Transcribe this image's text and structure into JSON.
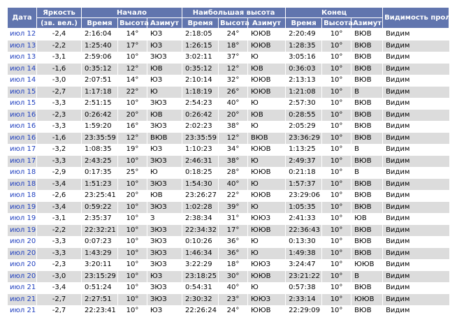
{
  "headers": {
    "date": "Дата",
    "brightness_line1": "Яркость",
    "brightness_line2": "(зв. вел.)",
    "start": "Начало",
    "max": "Наибольшая высота",
    "end": "Конец",
    "visibility": "Видимость пролёта",
    "time": "Время",
    "altitude": "Высота",
    "azimuth": "Азимут"
  },
  "colors": {
    "header_bg": "#6175ae",
    "row_alt_bg": "#dcdcdc",
    "link": "#1f3fbf"
  },
  "rows": [
    {
      "date": "июл 12",
      "mag": "-2,4",
      "t1": "2:16:04",
      "a1": "14°",
      "z1": "ЮЗ",
      "t2": "2:18:05",
      "a2": "24°",
      "z2": "ЮЮВ",
      "t3": "2:20:49",
      "a3": "10°",
      "z3": "ВЮВ",
      "vis": "Видим"
    },
    {
      "date": "июл 13",
      "mag": "-2,2",
      "t1": "1:25:40",
      "a1": "17°",
      "z1": "ЮЗ",
      "t2": "1:26:15",
      "a2": "18°",
      "z2": "ЮЮВ",
      "t3": "1:28:35",
      "a3": "10°",
      "z3": "ВЮВ",
      "vis": "Видим"
    },
    {
      "date": "июл 13",
      "mag": "-3,1",
      "t1": "2:59:06",
      "a1": "10°",
      "z1": "ЗЮЗ",
      "t2": "3:02:11",
      "a2": "37°",
      "z2": "Ю",
      "t3": "3:05:16",
      "a3": "10°",
      "z3": "ВЮВ",
      "vis": "Видим"
    },
    {
      "date": "июл 14",
      "mag": "-1,6",
      "t1": "0:35:12",
      "a1": "12°",
      "z1": "ЮВ",
      "t2": "0:35:12",
      "a2": "12°",
      "z2": "ЮВ",
      "t3": "0:36:03",
      "a3": "10°",
      "z3": "ВЮВ",
      "vis": "Видим"
    },
    {
      "date": "июл 14",
      "mag": "-3,0",
      "t1": "2:07:51",
      "a1": "14°",
      "z1": "ЮЗ",
      "t2": "2:10:14",
      "a2": "32°",
      "z2": "ЮЮВ",
      "t3": "2:13:13",
      "a3": "10°",
      "z3": "ВЮВ",
      "vis": "Видим"
    },
    {
      "date": "июл 15",
      "mag": "-2,7",
      "t1": "1:17:18",
      "a1": "22°",
      "z1": "Ю",
      "t2": "1:18:19",
      "a2": "26°",
      "z2": "ЮЮВ",
      "t3": "1:21:08",
      "a3": "10°",
      "z3": "В",
      "vis": "Видим"
    },
    {
      "date": "июл 15",
      "mag": "-3,3",
      "t1": "2:51:15",
      "a1": "10°",
      "z1": "ЗЮЗ",
      "t2": "2:54:23",
      "a2": "40°",
      "z2": "Ю",
      "t3": "2:57:30",
      "a3": "10°",
      "z3": "ВЮВ",
      "vis": "Видим"
    },
    {
      "date": "июл 16",
      "mag": "-2,3",
      "t1": "0:26:42",
      "a1": "20°",
      "z1": "ЮВ",
      "t2": "0:26:42",
      "a2": "20°",
      "z2": "ЮВ",
      "t3": "0:28:55",
      "a3": "10°",
      "z3": "ВЮВ",
      "vis": "Видим"
    },
    {
      "date": "июл 16",
      "mag": "-3,3",
      "t1": "1:59:20",
      "a1": "16°",
      "z1": "ЗЮЗ",
      "t2": "2:02:23",
      "a2": "38°",
      "z2": "Ю",
      "t3": "2:05:29",
      "a3": "10°",
      "z3": "ВЮВ",
      "vis": "Видим"
    },
    {
      "date": "июл 16",
      "mag": "-1,6",
      "t1": "23:35:59",
      "a1": "12°",
      "z1": "ВЮВ",
      "t2": "23:35:59",
      "a2": "12°",
      "z2": "ВЮВ",
      "t3": "23:36:29",
      "a3": "10°",
      "z3": "ВЮВ",
      "vis": "Видим"
    },
    {
      "date": "июл 17",
      "mag": "-3,2",
      "t1": "1:08:35",
      "a1": "19°",
      "z1": "ЮЗ",
      "t2": "1:10:23",
      "a2": "34°",
      "z2": "ЮЮВ",
      "t3": "1:13:25",
      "a3": "10°",
      "z3": "В",
      "vis": "Видим"
    },
    {
      "date": "июл 17",
      "mag": "-3,3",
      "t1": "2:43:25",
      "a1": "10°",
      "z1": "ЗЮЗ",
      "t2": "2:46:31",
      "a2": "38°",
      "z2": "Ю",
      "t3": "2:49:37",
      "a3": "10°",
      "z3": "ВЮВ",
      "vis": "Видим"
    },
    {
      "date": "июл 18",
      "mag": "-2,9",
      "t1": "0:17:35",
      "a1": "25°",
      "z1": "Ю",
      "t2": "0:18:25",
      "a2": "28°",
      "z2": "ЮЮВ",
      "t3": "0:21:18",
      "a3": "10°",
      "z3": "В",
      "vis": "Видим"
    },
    {
      "date": "июл 18",
      "mag": "-3,4",
      "t1": "1:51:23",
      "a1": "10°",
      "z1": "ЗЮЗ",
      "t2": "1:54:30",
      "a2": "40°",
      "z2": "Ю",
      "t3": "1:57:37",
      "a3": "10°",
      "z3": "ВЮВ",
      "vis": "Видим"
    },
    {
      "date": "июл 18",
      "mag": "-2,6",
      "t1": "23:25:41",
      "a1": "20°",
      "z1": "ЮВ",
      "t2": "23:26:27",
      "a2": "22°",
      "z2": "ЮЮВ",
      "t3": "23:29:06",
      "a3": "10°",
      "z3": "ВЮВ",
      "vis": "Видим"
    },
    {
      "date": "июл 19",
      "mag": "-3,4",
      "t1": "0:59:22",
      "a1": "10°",
      "z1": "ЗЮЗ",
      "t2": "1:02:28",
      "a2": "39°",
      "z2": "Ю",
      "t3": "1:05:35",
      "a3": "10°",
      "z3": "ВЮВ",
      "vis": "Видим"
    },
    {
      "date": "июл 19",
      "mag": "-3,1",
      "t1": "2:35:37",
      "a1": "10°",
      "z1": "З",
      "t2": "2:38:34",
      "a2": "31°",
      "z2": "ЮЮЗ",
      "t3": "2:41:33",
      "a3": "10°",
      "z3": "ЮВ",
      "vis": "Видим"
    },
    {
      "date": "июл 19",
      "mag": "-2,2",
      "t1": "22:32:21",
      "a1": "10°",
      "z1": "ЗЮЗ",
      "t2": "22:34:32",
      "a2": "17°",
      "z2": "ЮЮВ",
      "t3": "22:36:43",
      "a3": "10°",
      "z3": "ВЮВ",
      "vis": "Видим"
    },
    {
      "date": "июл 20",
      "mag": "-3,3",
      "t1": "0:07:23",
      "a1": "10°",
      "z1": "ЗЮЗ",
      "t2": "0:10:26",
      "a2": "36°",
      "z2": "Ю",
      "t3": "0:13:30",
      "a3": "10°",
      "z3": "ВЮВ",
      "vis": "Видим"
    },
    {
      "date": "июл 20",
      "mag": "-3,3",
      "t1": "1:43:29",
      "a1": "10°",
      "z1": "ЗЮЗ",
      "t2": "1:46:34",
      "a2": "36°",
      "z2": "Ю",
      "t3": "1:49:38",
      "a3": "10°",
      "z3": "ВЮВ",
      "vis": "Видим"
    },
    {
      "date": "июл 20",
      "mag": "-2,3",
      "t1": "3:20:11",
      "a1": "10°",
      "z1": "ЗЮЗ",
      "t2": "3:22:29",
      "a2": "18°",
      "z2": "ЮЮЗ",
      "t3": "3:24:47",
      "a3": "10°",
      "z3": "ЮЮВ",
      "vis": "Видим"
    },
    {
      "date": "июл 20",
      "mag": "-3,0",
      "t1": "23:15:29",
      "a1": "10°",
      "z1": "ЮЗ",
      "t2": "23:18:25",
      "a2": "30°",
      "z2": "ЮЮВ",
      "t3": "23:21:22",
      "a3": "10°",
      "z3": "В",
      "vis": "Видим"
    },
    {
      "date": "июл 21",
      "mag": "-3,4",
      "t1": "0:51:24",
      "a1": "10°",
      "z1": "ЗЮЗ",
      "t2": "0:54:31",
      "a2": "40°",
      "z2": "Ю",
      "t3": "0:57:38",
      "a3": "10°",
      "z3": "ВЮВ",
      "vis": "Видим"
    },
    {
      "date": "июл 21",
      "mag": "-2,7",
      "t1": "2:27:51",
      "a1": "10°",
      "z1": "ЗЮЗ",
      "t2": "2:30:32",
      "a2": "23°",
      "z2": "ЮЮЗ",
      "t3": "2:33:14",
      "a3": "10°",
      "z3": "ЮЮВ",
      "vis": "Видим"
    },
    {
      "date": "июл 21",
      "mag": "-2,7",
      "t1": "22:23:41",
      "a1": "10°",
      "z1": "ЮЗ",
      "t2": "22:26:24",
      "a2": "24°",
      "z2": "ЮЮВ",
      "t3": "22:29:09",
      "a3": "10°",
      "z3": "ВЮВ",
      "vis": "Видим"
    }
  ]
}
